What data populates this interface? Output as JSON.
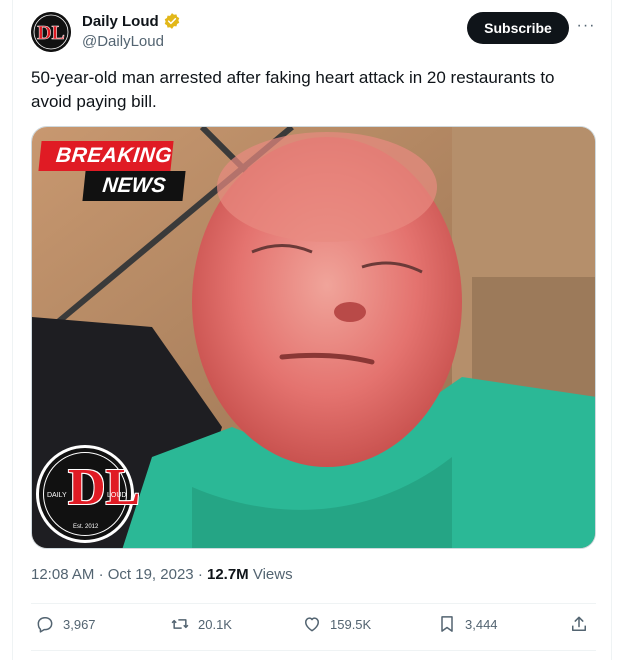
{
  "author": {
    "display_name": "Daily Loud",
    "handle": "@DailyLoud",
    "verified": true,
    "verified_color": "#e2b719"
  },
  "header": {
    "subscribe_label": "Subscribe",
    "more_icon": "ellipsis-icon"
  },
  "tweet": {
    "text": "50-year-old man arrested after faking heart attack in 20 restaurants to avoid paying bill."
  },
  "media": {
    "badge_top": "BREAKING",
    "badge_bottom": "NEWS",
    "logo_left": "DAILY",
    "logo_right": "LOUD",
    "logo_est": "Est. 2012",
    "logo_mark": "DL"
  },
  "meta": {
    "time": "12:08 AM",
    "date": "Oct 19, 2023",
    "separator": "·",
    "views": "12.7M",
    "views_label": "Views"
  },
  "actions": {
    "replies": "3,967",
    "reposts": "20.1K",
    "likes": "159.5K",
    "bookmarks": "3,444"
  },
  "colors": {
    "accent": "#0f1419",
    "muted": "#536471",
    "breaking_red": "#e01b24",
    "shirt_green": "#2bb896"
  }
}
